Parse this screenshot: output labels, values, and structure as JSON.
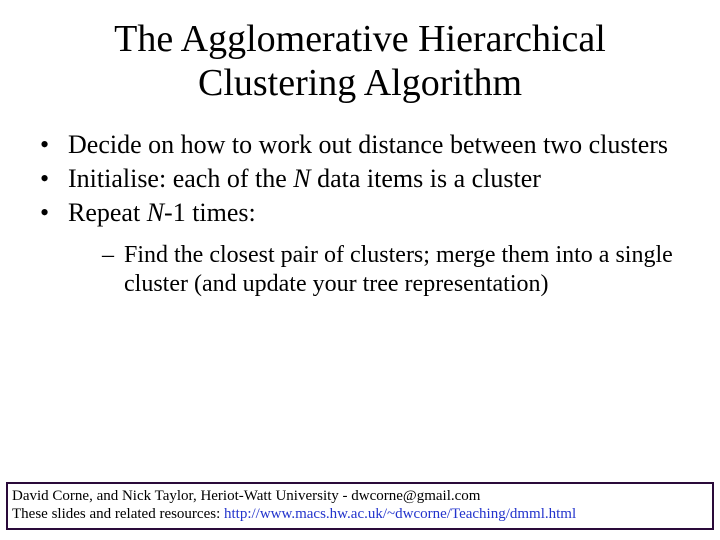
{
  "title": "The Agglomerative Hierarchical Clustering Algorithm",
  "bullets": {
    "b1": "Decide on how to work out distance between two clusters",
    "b2_pre": "Initialise: each of the ",
    "b2_N": "N",
    "b2_post": " data items is a cluster",
    "b3_pre": "Repeat ",
    "b3_N": "N",
    "b3_post": "-1 times:",
    "s1": "Find the closest pair of clusters; merge them into a single cluster (and update your tree representation)"
  },
  "footer": {
    "line1": "David Corne, and Nick Taylor,  Heriot-Watt University  -  dwcorne@gmail.com",
    "line2_pre": "These slides and related resources:   ",
    "line2_link": "http://www.macs.hw.ac.uk/~dwcorne/Teaching/dmml.html"
  }
}
